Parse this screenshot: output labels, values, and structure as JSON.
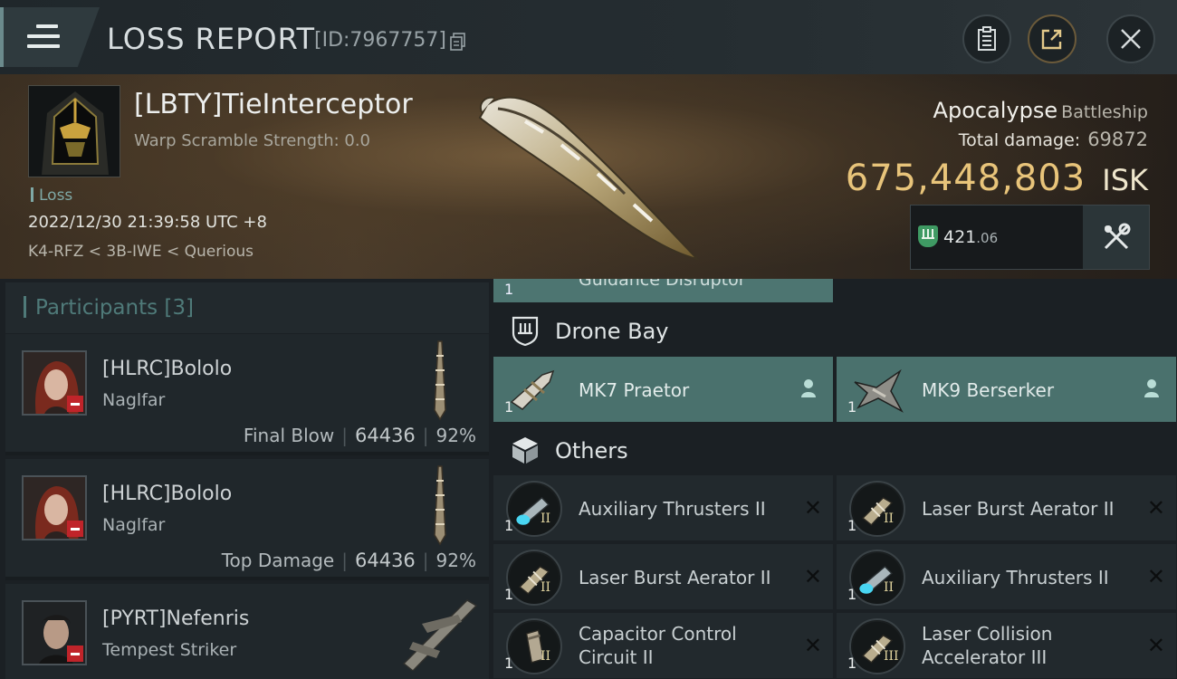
{
  "header": {
    "title": "LOSS REPORT",
    "report_id": "[ID:7967757]"
  },
  "victim": {
    "pilot": "[LBTY]TieInterceptor",
    "warp_scramble": "Warp Scramble Strength: 0.0",
    "status": "Loss",
    "datetime": "2022/12/30 21:39:58 UTC +8",
    "location": "K4-RFZ < 3B-IWE < Querious",
    "ship_name": "Apocalypse",
    "ship_class": "Battleship",
    "total_damage_label": "Total damage:",
    "total_damage": "69872",
    "isk_value": "675,448,803",
    "isk_unit": "ISK",
    "fit_value_main": "421",
    "fit_value_dec": ".06"
  },
  "participants": {
    "title": "Participants [3]",
    "list": [
      {
        "name": "[HLRC]Bololo",
        "ship": "Naglfar",
        "tag": "Final Blow",
        "damage": "64436",
        "percent": "92%"
      },
      {
        "name": "[HLRC]Bololo",
        "ship": "Naglfar",
        "tag": "Top Damage",
        "damage": "64436",
        "percent": "92%"
      },
      {
        "name": "[PYRT]Nefenris",
        "ship": "Tempest Striker",
        "tag": "",
        "damage": "",
        "percent": ""
      }
    ]
  },
  "fitting": {
    "partial_item": {
      "qty": "1",
      "name": "Guidance Disruptor"
    },
    "drone_bay": {
      "label": "Drone Bay",
      "items": [
        {
          "qty": "1",
          "name": "MK7  Praetor"
        },
        {
          "qty": "1",
          "name": "MK9  Berserker"
        }
      ]
    },
    "others": {
      "label": "Others",
      "items": [
        {
          "qty": "1",
          "meta": "II",
          "name": "Auxiliary Thrusters II",
          "icon": "thruster-icon"
        },
        {
          "qty": "1",
          "meta": "II",
          "name": "Laser Burst Aerator II",
          "icon": "aerator-icon"
        },
        {
          "qty": "1",
          "meta": "II",
          "name": "Laser Burst Aerator II",
          "icon": "aerator-icon"
        },
        {
          "qty": "1",
          "meta": "II",
          "name": "Auxiliary Thrusters II",
          "icon": "thruster-icon"
        },
        {
          "qty": "1",
          "meta": "II",
          "name": "Capacitor Control\nCircuit II",
          "icon": "capacitor-icon"
        },
        {
          "qty": "1",
          "meta": "III",
          "name": "Laser Collision\nAccelerator III",
          "icon": "accelerator-icon"
        }
      ]
    }
  },
  "colors": {
    "isk": "#e8c47a",
    "drone_bg": "#4a716d",
    "loss_tag": "#7fa9a6",
    "corp_flag": "#c0242a"
  }
}
